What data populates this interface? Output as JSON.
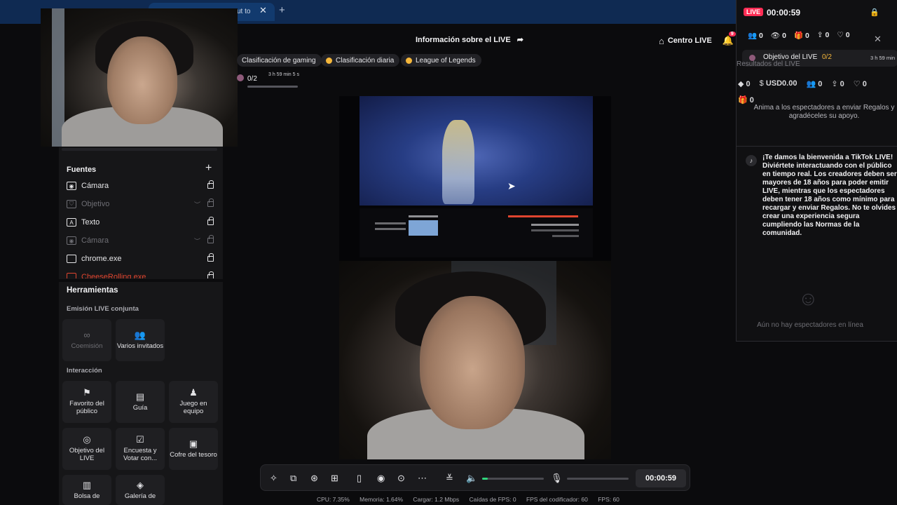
{
  "browser": {
    "tab_text": "ut to",
    "close": "✕",
    "add": "+"
  },
  "header": {
    "title": "Información sobre el LIVE",
    "centro_live": "Centro LIVE",
    "notif_count": "9"
  },
  "pills": [
    {
      "label": "Clasificación de gaming"
    },
    {
      "label": "Clasificación diaria"
    },
    {
      "label": "League of Legends"
    }
  ],
  "goal_widget": {
    "progress": "0/2",
    "time": "3 h 59 min 5 s"
  },
  "sources": {
    "title": "Fuentes",
    "add": "+",
    "items": [
      {
        "label": "Cámara"
      },
      {
        "label": "Objetivo"
      },
      {
        "label": "Texto"
      },
      {
        "label": "Cámara"
      },
      {
        "label": "chrome.exe"
      },
      {
        "label": "CheeseRolling.exe"
      }
    ]
  },
  "tools": {
    "title": "Herramientas",
    "coop_title": "Emisión LIVE conjunta",
    "coop": [
      {
        "label": "Coemisión"
      },
      {
        "label": "Varios invitados"
      }
    ],
    "interaction_title": "Interacción",
    "interaction": [
      {
        "label": "Favorito del público"
      },
      {
        "label": "Guía"
      },
      {
        "label": "Juego en equipo"
      },
      {
        "label": "Objetivo del LIVE"
      },
      {
        "label": "Encuesta y Votar con..."
      },
      {
        "label": "Cofre del tesoro"
      },
      {
        "label": "Bolsa de"
      },
      {
        "label": "Galería de"
      }
    ]
  },
  "controls": {
    "timer": "00:00:59"
  },
  "status": {
    "cpu": "CPU: 7.35%",
    "mem": "Memoria: 1.64%",
    "upload": "Cargar: 1.2 Mbps",
    "drops": "Caídas de FPS: 0",
    "encoder": "FPS del codificador: 60",
    "fps": "FPS: 60"
  },
  "live_panel": {
    "badge": "LIVE",
    "timer": "00:00:59",
    "stats": [
      "0",
      "0",
      "0",
      "0",
      "0",
      "0"
    ],
    "goal_label": "Objetivo del LIVE",
    "goal_progress": "0/2",
    "goal_time": "3 h 59 min",
    "results_title": "Resultados del LIVE",
    "money": [
      "0",
      "USD0.00",
      "0",
      "0",
      "0"
    ],
    "gifts": "0",
    "encourage": "Anima a los espectadores a enviar Regalos y agradéceles su apoyo.",
    "welcome": "¡Te damos la bienvenida a TikTok LIVE! Diviértete interactuando con el público en tiempo real. Los creadores deben ser mayores de 18 años para poder emitir LIVE, mientras que los espectadores deben tener 18 años como mínimo para recargar y enviar Regalos. No te olvides crear una experiencia segura cumpliendo las Normas de la comunidad.",
    "no_viewers": "Aún no hay espectadores en línea"
  },
  "colors": {
    "live_red": "#ff2d55",
    "coin": "#f5b73b",
    "accent_green": "#2fd67c"
  }
}
